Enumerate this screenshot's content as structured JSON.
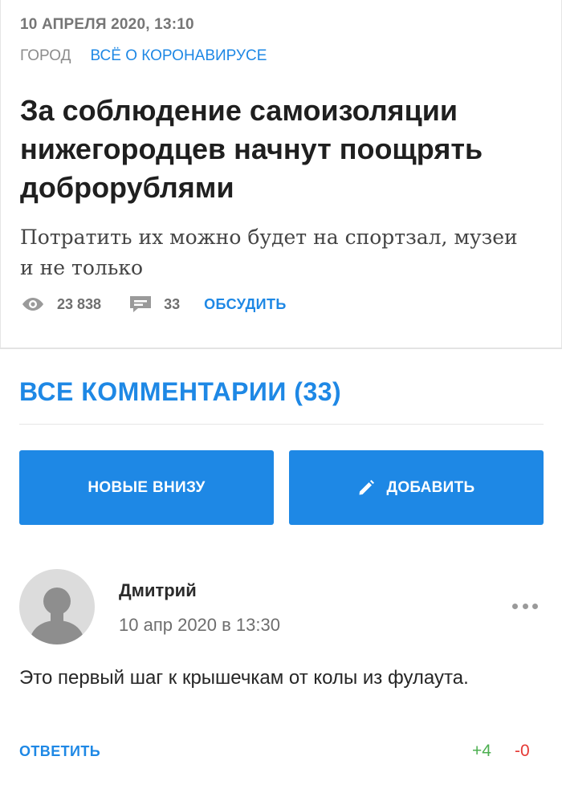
{
  "article": {
    "date": "10 АПРЕЛЯ 2020, 13:10",
    "rubrics": [
      "ГОРОД",
      "ВСЁ О КОРОНАВИРУСЕ"
    ],
    "headline": "За соблюдение самоизоляции нижегородцев начнут поощрять доброрублями",
    "subtitle": "Потратить их можно будет на спортзал, музеи и не только",
    "views": "23 838",
    "comments_count": "33",
    "discuss_label": "ОБСУДИТЬ"
  },
  "comments_section": {
    "title": "ВСЕ КОММЕНТАРИИ (33)",
    "order_button": "НОВЫЕ ВНИЗУ",
    "add_button": "ДОБАВИТЬ"
  },
  "comment": {
    "author": "Дмитрий",
    "date": "10 апр 2020 в 13:30",
    "text": "Это первый шаг к крышечкам от колы из фулаута.",
    "reply_label": "ОТВЕТИТЬ",
    "votes_up": "+4",
    "votes_down": "-0"
  },
  "icons": {
    "views": "eye-icon",
    "comments": "speech-bubble-icon",
    "add": "pencil-icon",
    "more": "more-dots-icon",
    "avatar": "user-silhouette-icon"
  },
  "colors": {
    "accent": "#1e88e5",
    "positive": "#4caf50",
    "negative": "#e53935"
  }
}
